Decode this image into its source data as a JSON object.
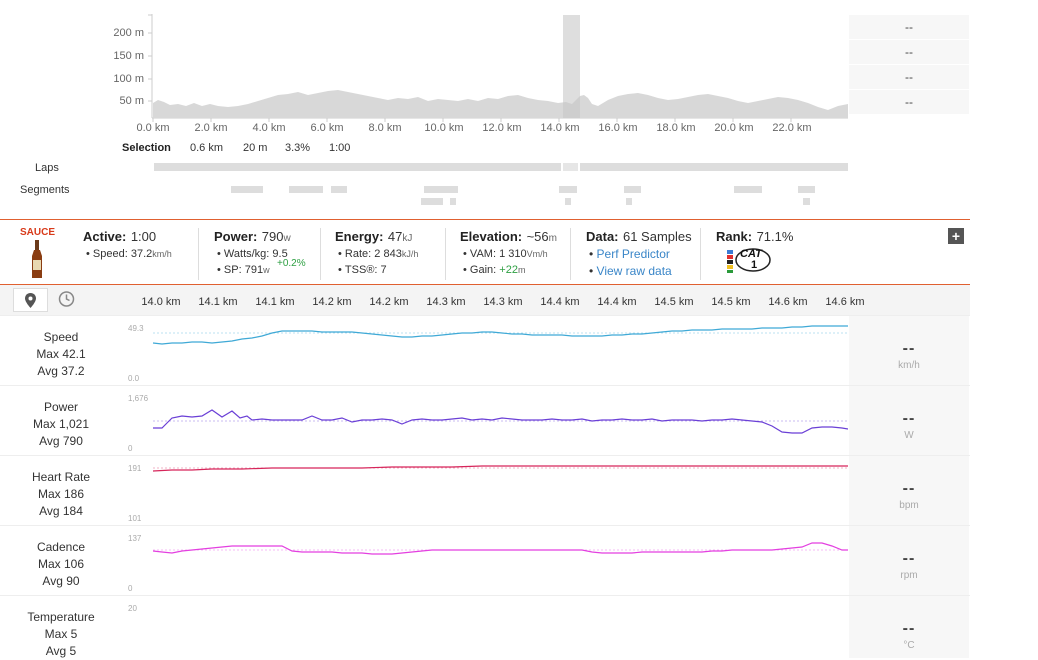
{
  "elevation": {
    "y_ticks": [
      "200 m",
      "150 m",
      "100 m",
      "50 m"
    ],
    "x_ticks": [
      "0.0 km",
      "2.0 km",
      "4.0 km",
      "6.0 km",
      "8.0 km",
      "10.0 km",
      "12.0 km",
      "14.0 km",
      "16.0 km",
      "18.0 km",
      "20.0 km",
      "22.0 km"
    ],
    "right_values": [
      "--",
      "--",
      "--",
      "--"
    ]
  },
  "selection": {
    "label": "Selection",
    "distance": "0.6 km",
    "elevation": "20 m",
    "grade": "3.3%",
    "time": "1:00"
  },
  "rows": {
    "laps": "Laps",
    "segments": "Segments"
  },
  "stats": {
    "logo": "SAUCE",
    "active": {
      "label": "Active:",
      "value": "1:00",
      "speed_label": "Speed:",
      "speed_value": "37.2",
      "speed_unit": "km/h"
    },
    "power": {
      "label": "Power:",
      "value": "790",
      "unit": "w",
      "wkg_label": "Watts/kg:",
      "wkg_value": "9.5",
      "sp_label": "SP:",
      "sp_value": "791",
      "sp_unit": "w",
      "sp_delta": "+0.2%"
    },
    "energy": {
      "label": "Energy:",
      "value": "47",
      "unit": "kJ",
      "rate_label": "Rate:",
      "rate_value": "2 843",
      "rate_unit": "kJ/h",
      "tss_label": "TSS®:",
      "tss_value": "7"
    },
    "elevation": {
      "label": "Elevation:",
      "value": "~56",
      "unit": "m",
      "vam_label": "VAM:",
      "vam_value": "1 310",
      "vam_unit": "Vm/h",
      "gain_label": "Gain:",
      "gain_value": "+22",
      "gain_unit": "m"
    },
    "data": {
      "label": "Data:",
      "value": "61 Samples",
      "link1": "Perf Predictor",
      "link2": "View raw data"
    },
    "rank": {
      "label": "Rank:",
      "value": "71.1%",
      "badge": "CAT",
      "badge_num": "1"
    },
    "expand": "+"
  },
  "detail_x_ticks": [
    "14.0 km",
    "14.1 km",
    "14.1 km",
    "14.2 km",
    "14.2 km",
    "14.3 km",
    "14.3 km",
    "14.4 km",
    "14.4 km",
    "14.5 km",
    "14.5 km",
    "14.6 km",
    "14.6 km"
  ],
  "charts": [
    {
      "name": "Speed",
      "max": "Max 42.1",
      "avg": "Avg 37.2",
      "ymax": "49.3",
      "ymin": "0.0",
      "value": "--",
      "unit": "km/h",
      "color": "#3fa9d6"
    },
    {
      "name": "Power",
      "max": "Max 1,021",
      "avg": "Avg 790",
      "ymax": "1,676",
      "ymin": "0",
      "value": "--",
      "unit": "W",
      "color": "#6a3fd6"
    },
    {
      "name": "Heart Rate",
      "max": "Max 186",
      "avg": "Avg 184",
      "ymax": "191",
      "ymin": "101",
      "value": "--",
      "unit": "bpm",
      "color": "#d6255a"
    },
    {
      "name": "Cadence",
      "max": "Max 106",
      "avg": "Avg 90",
      "ymax": "137",
      "ymin": "0",
      "value": "--",
      "unit": "rpm",
      "color": "#e33fe0"
    },
    {
      "name": "Temperature",
      "max": "Max 5",
      "avg": "Avg 5",
      "ymax": "20",
      "ymin": "",
      "value": "--",
      "unit": "°C",
      "color": "#999999"
    }
  ]
}
